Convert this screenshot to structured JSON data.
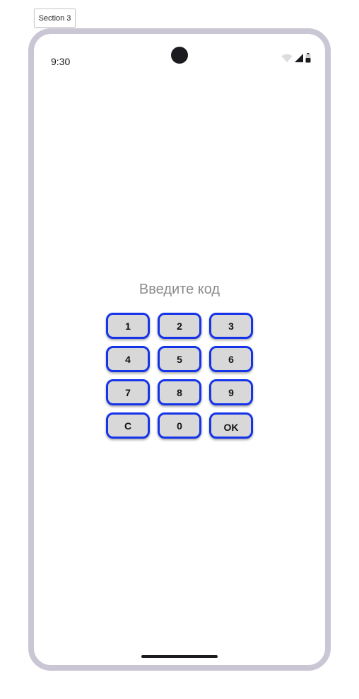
{
  "section_tag": "Section 3",
  "status_bar": {
    "time": "9:30",
    "icons": [
      "wifi-icon",
      "cellular-signal-icon",
      "battery-icon"
    ]
  },
  "prompt": "Введите код",
  "keypad": {
    "keys": [
      "1",
      "2",
      "3",
      "4",
      "5",
      "6",
      "7",
      "8",
      "9",
      "C",
      "0",
      "OK"
    ]
  },
  "colors": {
    "frame": "#cbc6d4",
    "key_border": "#1533e8",
    "key_fill": "#d8d8d8",
    "prompt_text": "#8c8c8c"
  }
}
